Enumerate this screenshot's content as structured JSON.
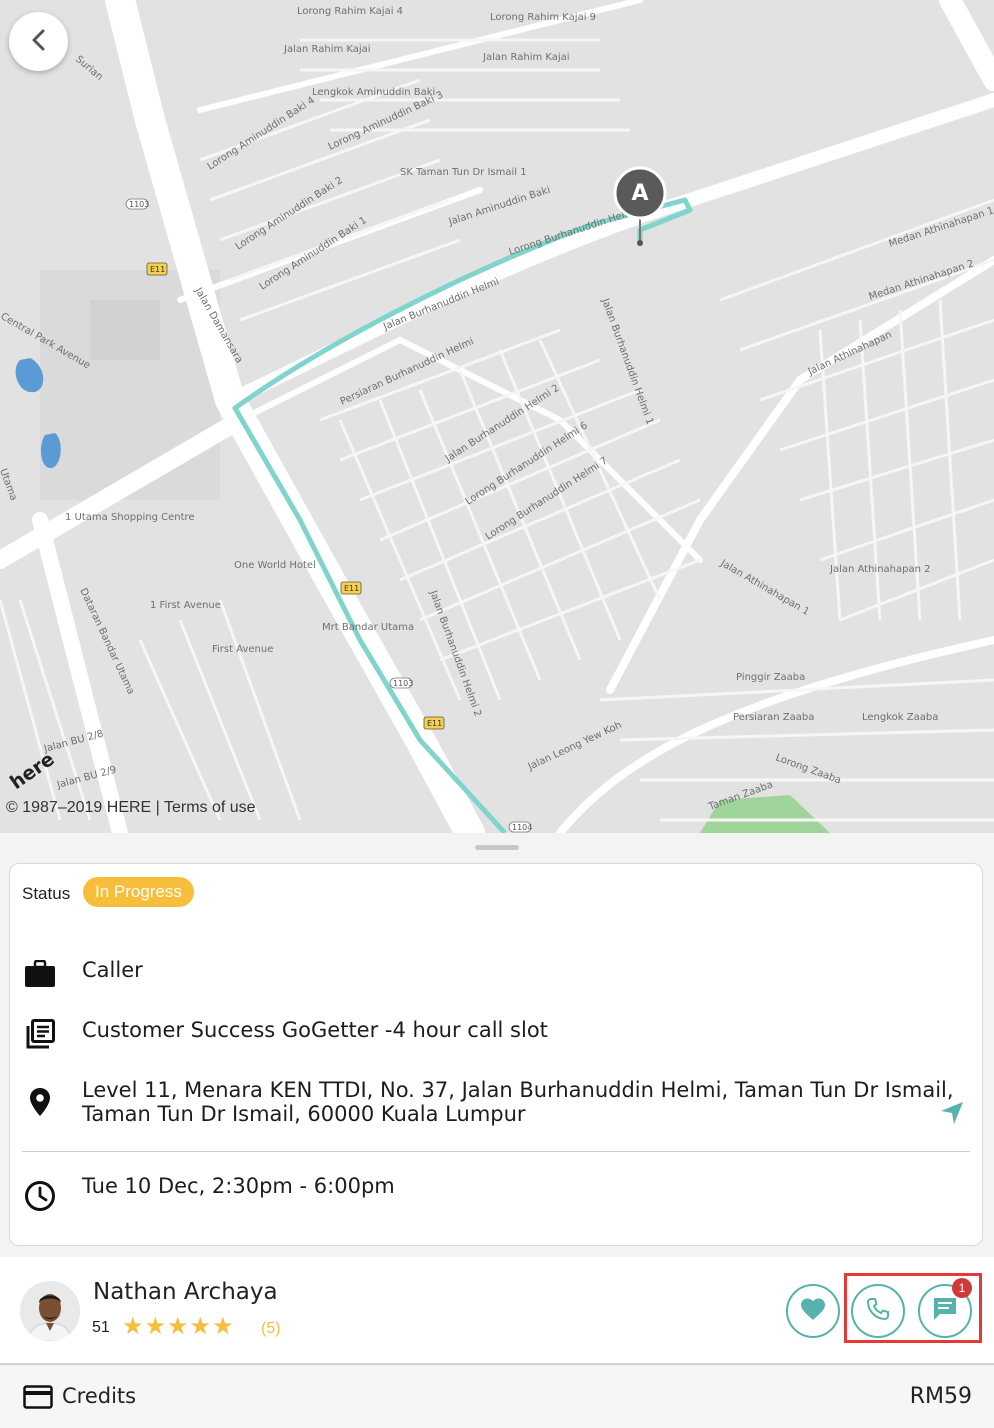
{
  "map": {
    "marker_label": "A",
    "attribution": "© 1987–2019 HERE | Terms of use",
    "logo_text": "here",
    "route_color": "#7fd4cc",
    "labels": [
      "Lorong Rahim Kajai 4",
      "Lorong Rahim Kajai 9",
      "Jalan Rahim Kajai",
      "Jalan Rahim Kajai",
      "Lengkok Aminuddin Baki",
      "Lorong Aminuddin Baki 4",
      "Lorong Aminuddin Baki 3",
      "SK Taman Tun Dr Ismail 1",
      "Lorong Aminuddin Baki 2",
      "Lorong Aminuddin Baki 1",
      "Jalan Aminuddin Baki",
      "Lorong Burhanuddin Helmi",
      "Jalan Burhanuddin Helmi",
      "Jalan Damansara",
      "Persiaran Burhanuddin Helmi",
      "Jalan Burhanuddin Helmi 2",
      "Lorong Burhanuddin Helmi 6",
      "Lorong Burhanuddin Helmi 7",
      "Jalan Burhanuddin Helmi 1",
      "Medan Athinahapan 1",
      "Medan Athinahapan 2",
      "Jalan Athinahapan",
      "Jalan Athinahapan 2",
      "Jalan Athinahapan 1",
      "1 Utama Shopping Centre",
      "One World Hotel",
      "1 First Avenue",
      "Mrt Bandar Utama",
      "First Avenue",
      "Dataran Bandar Utama",
      "Jalan Leong Yew Koh",
      "Pinggir Zaaba",
      "Persiaran Zaaba",
      "Lengkok Zaaba",
      "Lorong Zaaba",
      "Taman Zaaba",
      "Jalan BU 2/8",
      "Jalan BU 2/9",
      "Surian",
      "Central Park Avenue",
      "Utama",
      "Jalan Burhanuddin Helmi 2"
    ]
  },
  "status": {
    "label": "Status",
    "value": "In Progress",
    "badge_color": "#f7be3b"
  },
  "details": {
    "type": "Caller",
    "service": "Customer Success GoGetter -4 hour call slot",
    "address_line1": "Level 11, Menara KEN TTDI, No. 37, Jalan Burhanuddin Helmi, Taman Tun Dr Ismail,",
    "address_line2": "Taman Tun Dr Ismail, 60000 Kuala Lumpur",
    "time": "Tue 10 Dec, 2:30pm - 6:00pm"
  },
  "agent": {
    "name": "Nathan Archaya",
    "jobs_count": "51",
    "stars": "★★★★★",
    "rating": 5,
    "rating_count": "(5)",
    "message_badge": "1",
    "accent_color": "#55b3ad"
  },
  "credits": {
    "label": "Credits",
    "value": "RM59"
  }
}
